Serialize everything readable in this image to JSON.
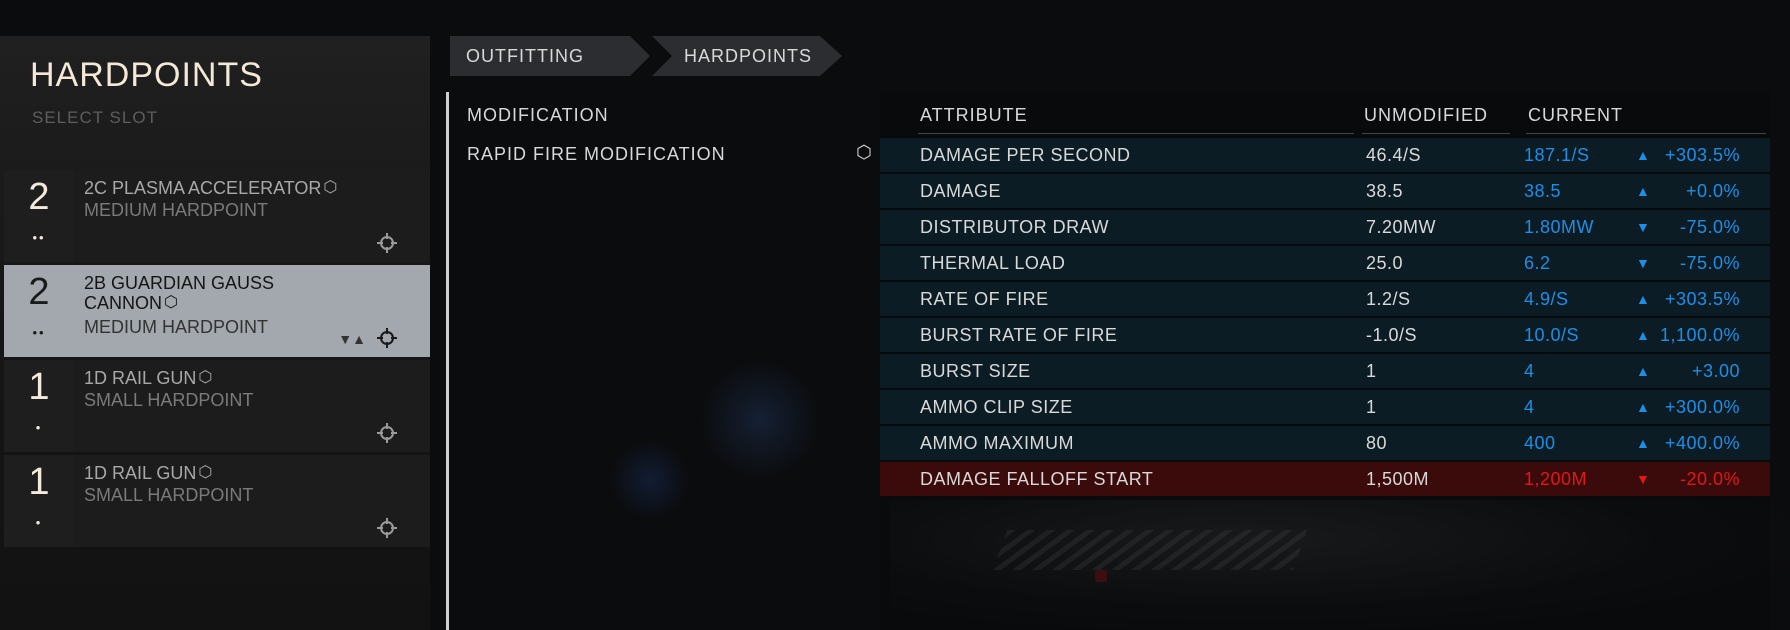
{
  "left_panel": {
    "title": "HARDPOINTS",
    "subtitle": "SELECT SLOT",
    "slots": [
      {
        "size": "2",
        "pips": "••",
        "name": "2C PLASMA ACCELERATOR",
        "type": "MEDIUM HARDPOINT"
      },
      {
        "size": "2",
        "pips": "••",
        "name_line1": "2B GUARDIAN GAUSS",
        "name_line2": "CANNON",
        "type": "MEDIUM HARDPOINT"
      },
      {
        "size": "1",
        "pips": "•",
        "name": "1D RAIL GUN",
        "type": "SMALL HARDPOINT"
      },
      {
        "size": "1",
        "pips": "•",
        "name": "1D RAIL GUN",
        "type": "SMALL HARDPOINT"
      }
    ]
  },
  "breadcrumb": [
    "OUTFITTING",
    "HARDPOINTS"
  ],
  "modification": {
    "header": "MODIFICATION",
    "name": "RAPID FIRE MODIFICATION"
  },
  "table": {
    "headers": {
      "attribute": "ATTRIBUTE",
      "unmodified": "UNMODIFIED",
      "current": "CURRENT"
    },
    "rows": [
      {
        "attribute": "DAMAGE PER SECOND",
        "unmodified": "46.4/S",
        "current": "187.1/S",
        "arrow": "▲",
        "change": "+303.5%"
      },
      {
        "attribute": "DAMAGE",
        "unmodified": "38.5",
        "current": "38.5",
        "arrow": "▲",
        "change": "+0.0%"
      },
      {
        "attribute": "DISTRIBUTOR DRAW",
        "unmodified": "7.20MW",
        "current": "1.80MW",
        "arrow": "▼",
        "change": "-75.0%"
      },
      {
        "attribute": "THERMAL LOAD",
        "unmodified": "25.0",
        "current": "6.2",
        "arrow": "▼",
        "change": "-75.0%"
      },
      {
        "attribute": "RATE OF FIRE",
        "unmodified": "1.2/S",
        "current": "4.9/S",
        "arrow": "▲",
        "change": "+303.5%"
      },
      {
        "attribute": "BURST RATE OF FIRE",
        "unmodified": "-1.0/S",
        "current": "10.0/S",
        "arrow": "▲",
        "change": "1,100.0%"
      },
      {
        "attribute": "BURST SIZE",
        "unmodified": "1",
        "current": "4",
        "arrow": "▲",
        "change": "+3.00"
      },
      {
        "attribute": "AMMO CLIP SIZE",
        "unmodified": "1",
        "current": "4",
        "arrow": "▲",
        "change": "+300.0%"
      },
      {
        "attribute": "AMMO MAXIMUM",
        "unmodified": "80",
        "current": "400",
        "arrow": "▲",
        "change": "+400.0%"
      },
      {
        "attribute": "DAMAGE FALLOFF START",
        "unmodified": "1,500M",
        "current": "1,200M",
        "arrow": "▼",
        "change": "-20.0%"
      }
    ]
  },
  "icons": {
    "modification": "hexagon-mod-icon",
    "target": "crosshair-icon",
    "engineer": "engineer-triangle-icon"
  },
  "colors": {
    "positive": "#1e8ee6",
    "negative": "#e01818",
    "accent_text": "#f4e8d6",
    "selected_slot": "#a2a8ad"
  }
}
